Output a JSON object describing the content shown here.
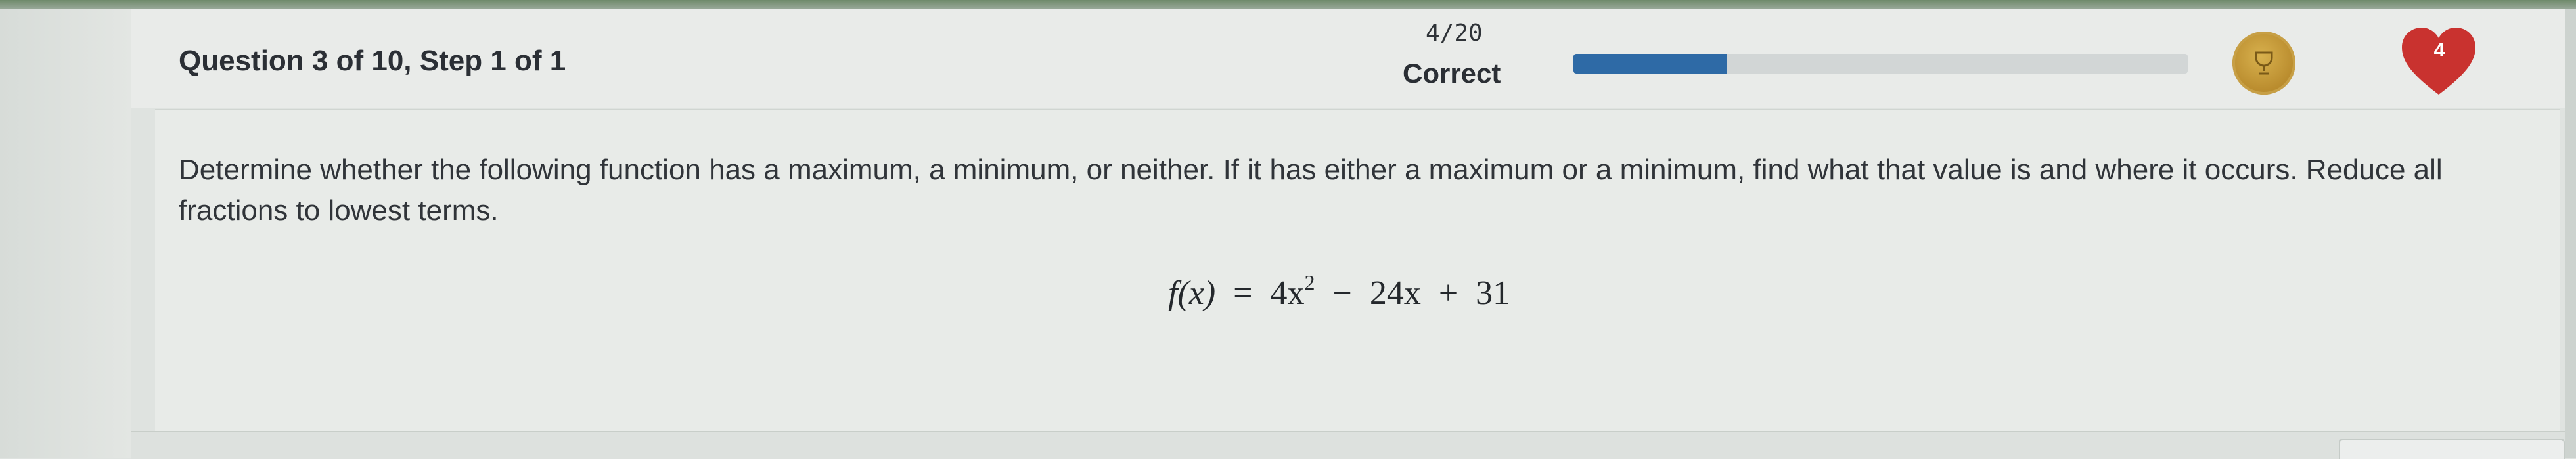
{
  "header": {
    "question_label": "Question 3 of 10, Step 1 of 1",
    "score": "4/20",
    "status": "Correct",
    "progress_fraction": 0.25,
    "coin_icon": "trophy-coin-icon",
    "lives_count": "4",
    "heart_color": "#c9322f"
  },
  "question": {
    "text": "Determine whether the following function has a maximum, a minimum, or neither. If it has either a maximum or a minimum, find what that value is and where it occurs. Reduce all fractions to lowest terms.",
    "formula": {
      "lhs": "f(x)",
      "equals": "=",
      "t1": "4x",
      "t1_exp": "2",
      "op1": "−",
      "t2": "24x",
      "op2": "+",
      "t3": "31"
    }
  },
  "colors": {
    "accent": "#2e6aa6",
    "heart": "#c9322f",
    "coin": "#b88a2c"
  }
}
